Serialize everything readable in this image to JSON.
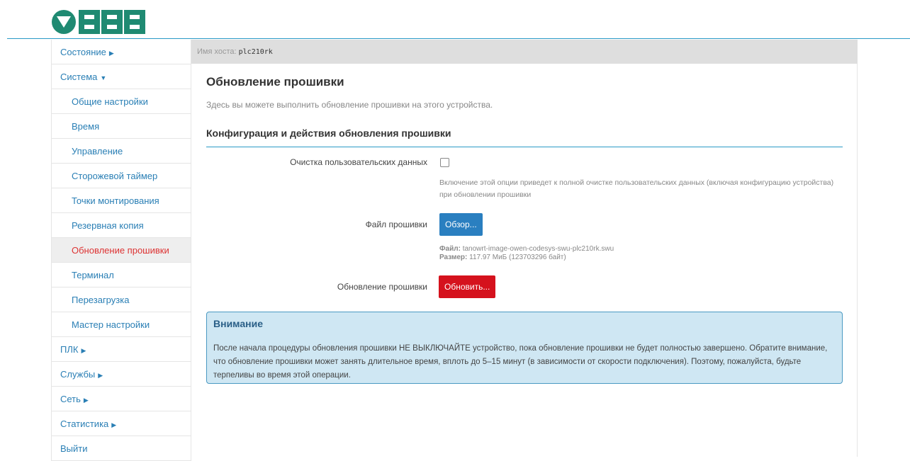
{
  "brand": {
    "logo_text": "ОВЕН",
    "accent": "#1f8a72"
  },
  "host": {
    "label": "Имя хоста:",
    "value": "plc210rk"
  },
  "sidebar": {
    "items": [
      {
        "label": "Состояние",
        "arrow": "▶"
      },
      {
        "label": "Система",
        "arrow": "▼"
      },
      {
        "label": "Общие настройки"
      },
      {
        "label": "Время"
      },
      {
        "label": "Управление"
      },
      {
        "label": "Сторожевой таймер"
      },
      {
        "label": "Точки монтирования"
      },
      {
        "label": "Резервная копия"
      },
      {
        "label": "Обновление прошивки"
      },
      {
        "label": "Терминал"
      },
      {
        "label": "Перезагрузка"
      },
      {
        "label": "Мастер настройки"
      },
      {
        "label": "ПЛК",
        "arrow": "▶"
      },
      {
        "label": "Службы",
        "arrow": "▶"
      },
      {
        "label": "Сеть",
        "arrow": "▶"
      },
      {
        "label": "Статистика",
        "arrow": "▶"
      },
      {
        "label": "Выйти"
      }
    ]
  },
  "main": {
    "title": "Обновление прошивки",
    "description": "Здесь вы можете выполнить обновление прошивки на этого устройства.",
    "section_title": "Конфигурация и действия обновления прошивки",
    "clear_label": "Очистка пользовательских данных",
    "clear_hint": "Включение этой опции приведет к полной очистке пользовательских данных (включая конфигурацию устройства) при обновлении прошивки",
    "file_label": "Файл прошивки",
    "browse_button": "Обзор...",
    "file_name_label": "Файл:",
    "file_name": "tanowrt-image-owen-codesys-swu-plc210rk.swu",
    "file_size_label": "Размер:",
    "file_size": "117.97 МиБ (123703296 байт)",
    "update_label": "Обновление прошивки",
    "update_button": "Обновить..."
  },
  "alert": {
    "title": "Внимание",
    "text": "После начала процедуры обновления прошивки НЕ ВЫКЛЮЧАЙТЕ устройство, пока обновление прошивки не будет полностью завершено. Обратите внимание, что обновление прошивки может занять длительное время, вплоть до 5–15 минут (в зависимости от скорости подключения). Поэтому, пожалуйста, будьте терпеливы во время этой операции."
  }
}
